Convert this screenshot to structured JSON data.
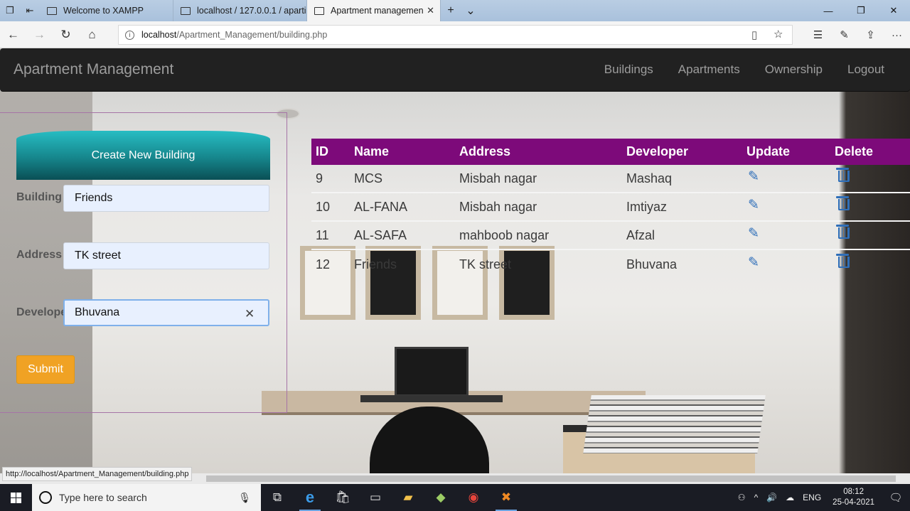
{
  "browser": {
    "tabs": [
      {
        "label": "Welcome to XAMPP",
        "active": false
      },
      {
        "label": "localhost / 127.0.0.1 / aparti",
        "active": false
      },
      {
        "label": "Apartment managemen",
        "active": true
      }
    ],
    "url_host": "localhost",
    "url_path": "/Apartment_Management/building.php",
    "status_url": "http://localhost/Apartment_Management/building.php"
  },
  "navbar": {
    "brand": "Apartment Management",
    "links": [
      "Buildings",
      "Apartments",
      "Ownership",
      "Logout"
    ]
  },
  "form": {
    "heading": "Create New Building",
    "fields": [
      {
        "label": "Building",
        "value": "Friends"
      },
      {
        "label": "Address",
        "value": "TK street"
      },
      {
        "label": "Developer",
        "value": "Bhuvana"
      }
    ],
    "submit_label": "Submit"
  },
  "table": {
    "headers": [
      "ID",
      "Name",
      "Address",
      "Developer",
      "Update",
      "Delete"
    ],
    "rows": [
      {
        "id": "9",
        "name": "MCS",
        "address": "Misbah nagar",
        "developer": "Mashaq"
      },
      {
        "id": "10",
        "name": "AL-FANA",
        "address": "Misbah nagar",
        "developer": "Imtiyaz"
      },
      {
        "id": "11",
        "name": "AL-SAFA",
        "address": "mahboob nagar",
        "developer": "Afzal"
      },
      {
        "id": "12",
        "name": "Friends",
        "address": "TK street",
        "developer": "Bhuvana"
      }
    ]
  },
  "taskbar": {
    "search_placeholder": "Type here to search",
    "language": "ENG",
    "time": "08:12",
    "date": "25-04-2021"
  },
  "colors": {
    "table_header": "#7d0a7a",
    "submit": "#f0a224",
    "create_header": "#1a9ea4",
    "navbar": "#212121"
  }
}
